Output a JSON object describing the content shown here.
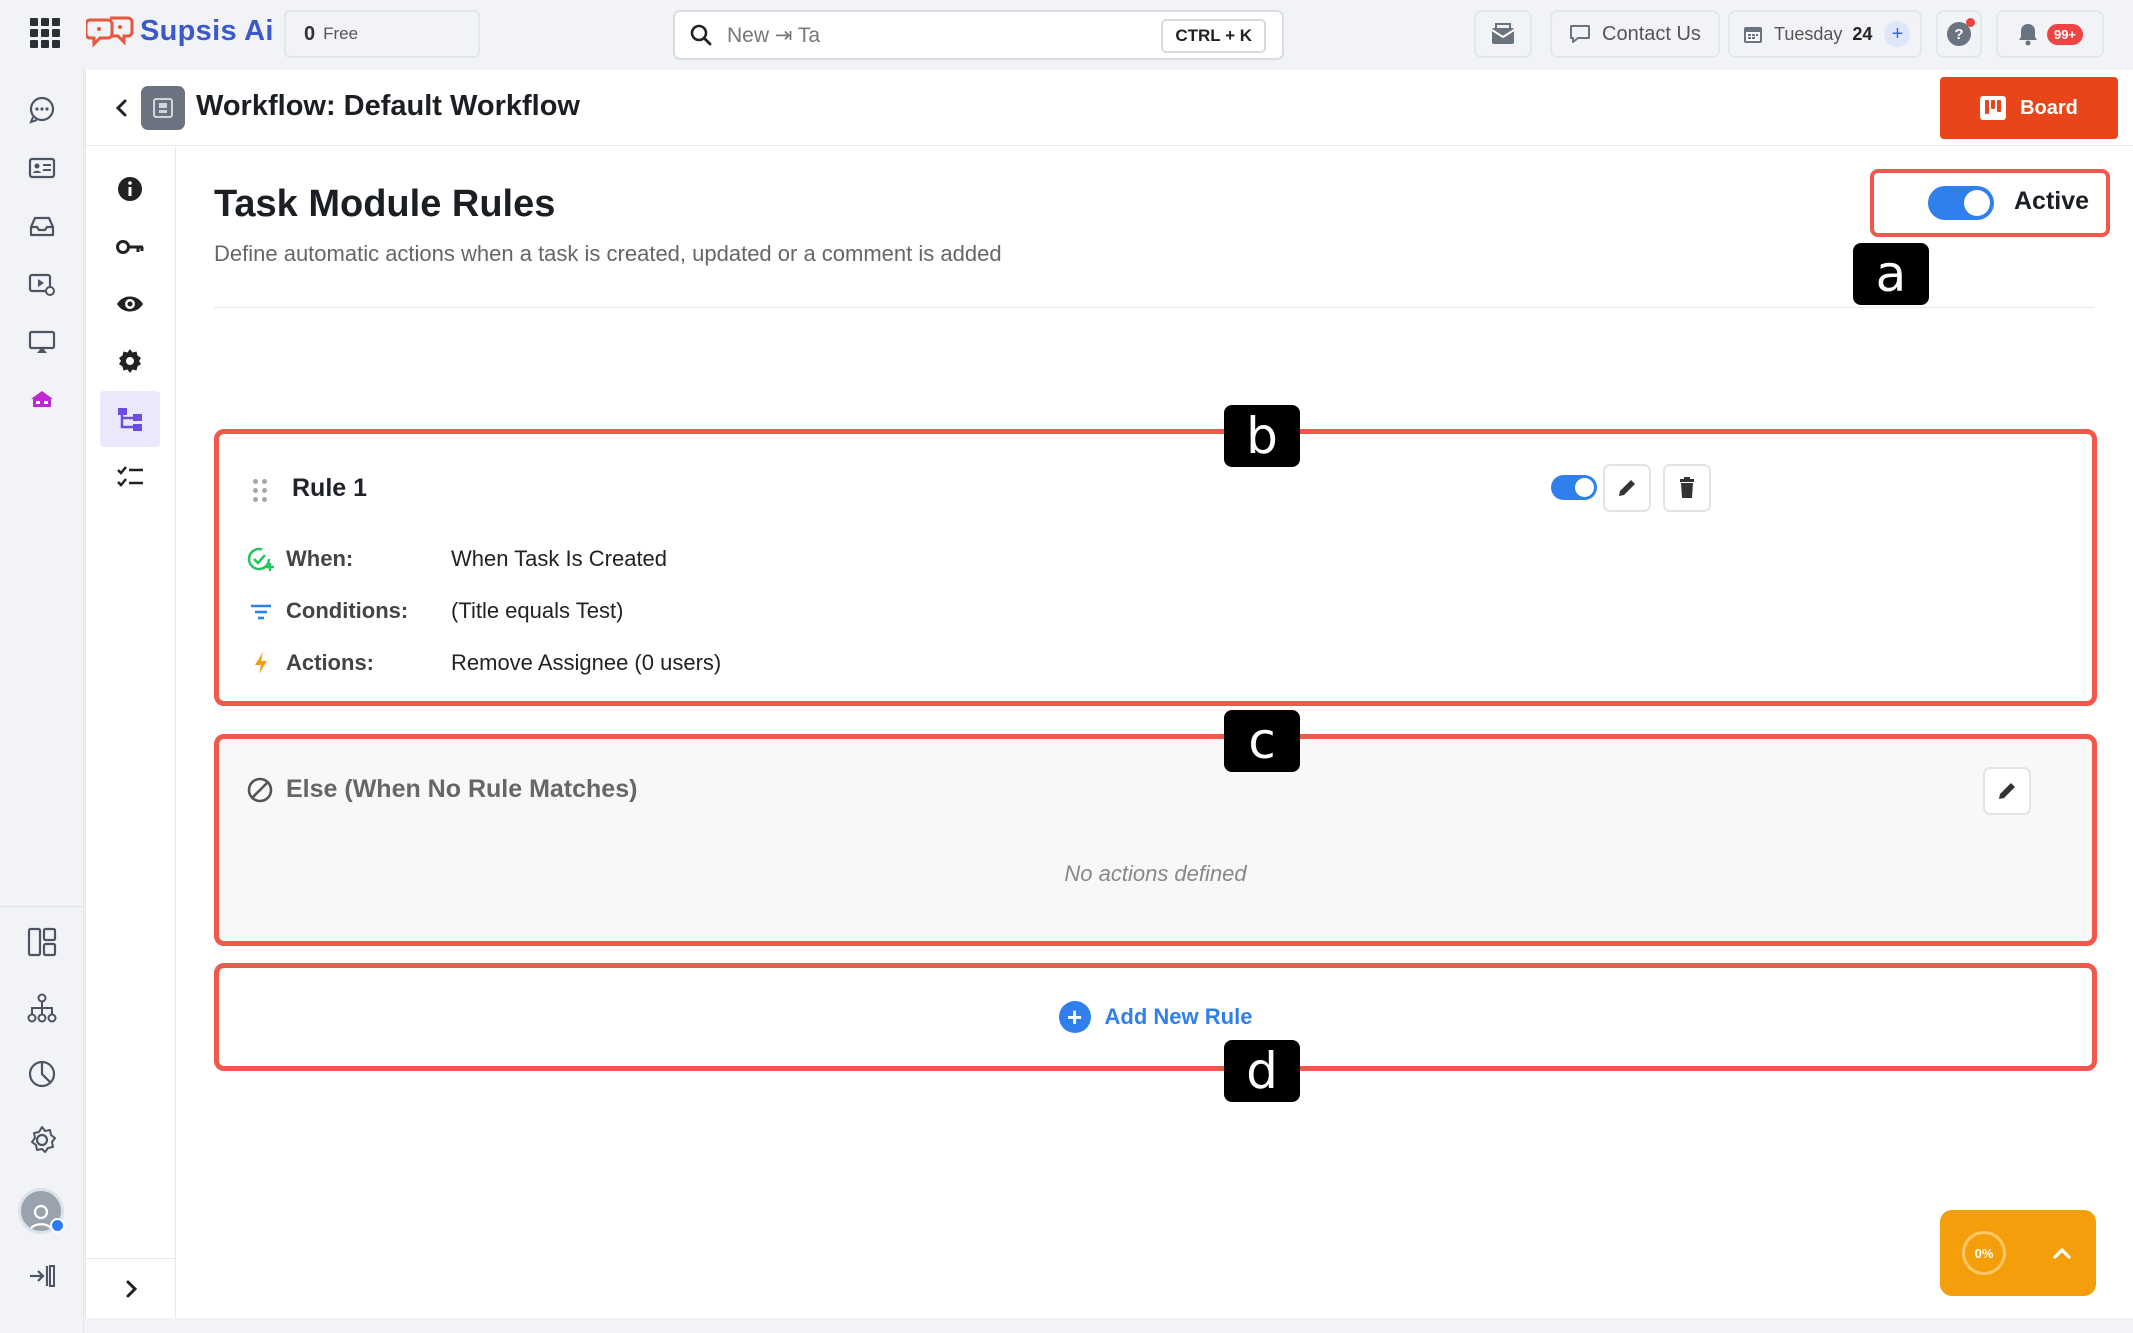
{
  "topbar": {
    "brand": "Supsis Ai",
    "credits_value": "0",
    "credits_label": "Free",
    "search_value": "New ⇥ Ta",
    "search_shortcut": "CTRL + K",
    "contact_label": "Contact Us",
    "date_label": "Tuesday",
    "date_day": "24",
    "notifications_badge": "99+"
  },
  "header": {
    "title": "Workflow: Default Workflow",
    "board_label": "Board"
  },
  "rules": {
    "title": "Task Module Rules",
    "subtitle": "Define automatic actions when a task is created, updated or a comment is added",
    "active_label": "Active",
    "rule1": {
      "name": "Rule 1",
      "when_label": "When:",
      "when_value": "When Task Is Created",
      "conditions_label": "Conditions:",
      "conditions_value": "(Title equals Test)",
      "actions_label": "Actions:",
      "actions_value": "Remove Assignee (0 users)"
    },
    "else": {
      "title": "Else (When No Rule Matches)",
      "empty": "No actions defined"
    },
    "add_label": "Add New Rule"
  },
  "markers": {
    "a": "a",
    "b": "b",
    "c": "c",
    "d": "d"
  },
  "progress": {
    "value": "0%"
  },
  "colors": {
    "accent": "#2f80ed",
    "brand": "#e8461a",
    "highlight": "#f0584b",
    "fab": "#f59e0b"
  }
}
